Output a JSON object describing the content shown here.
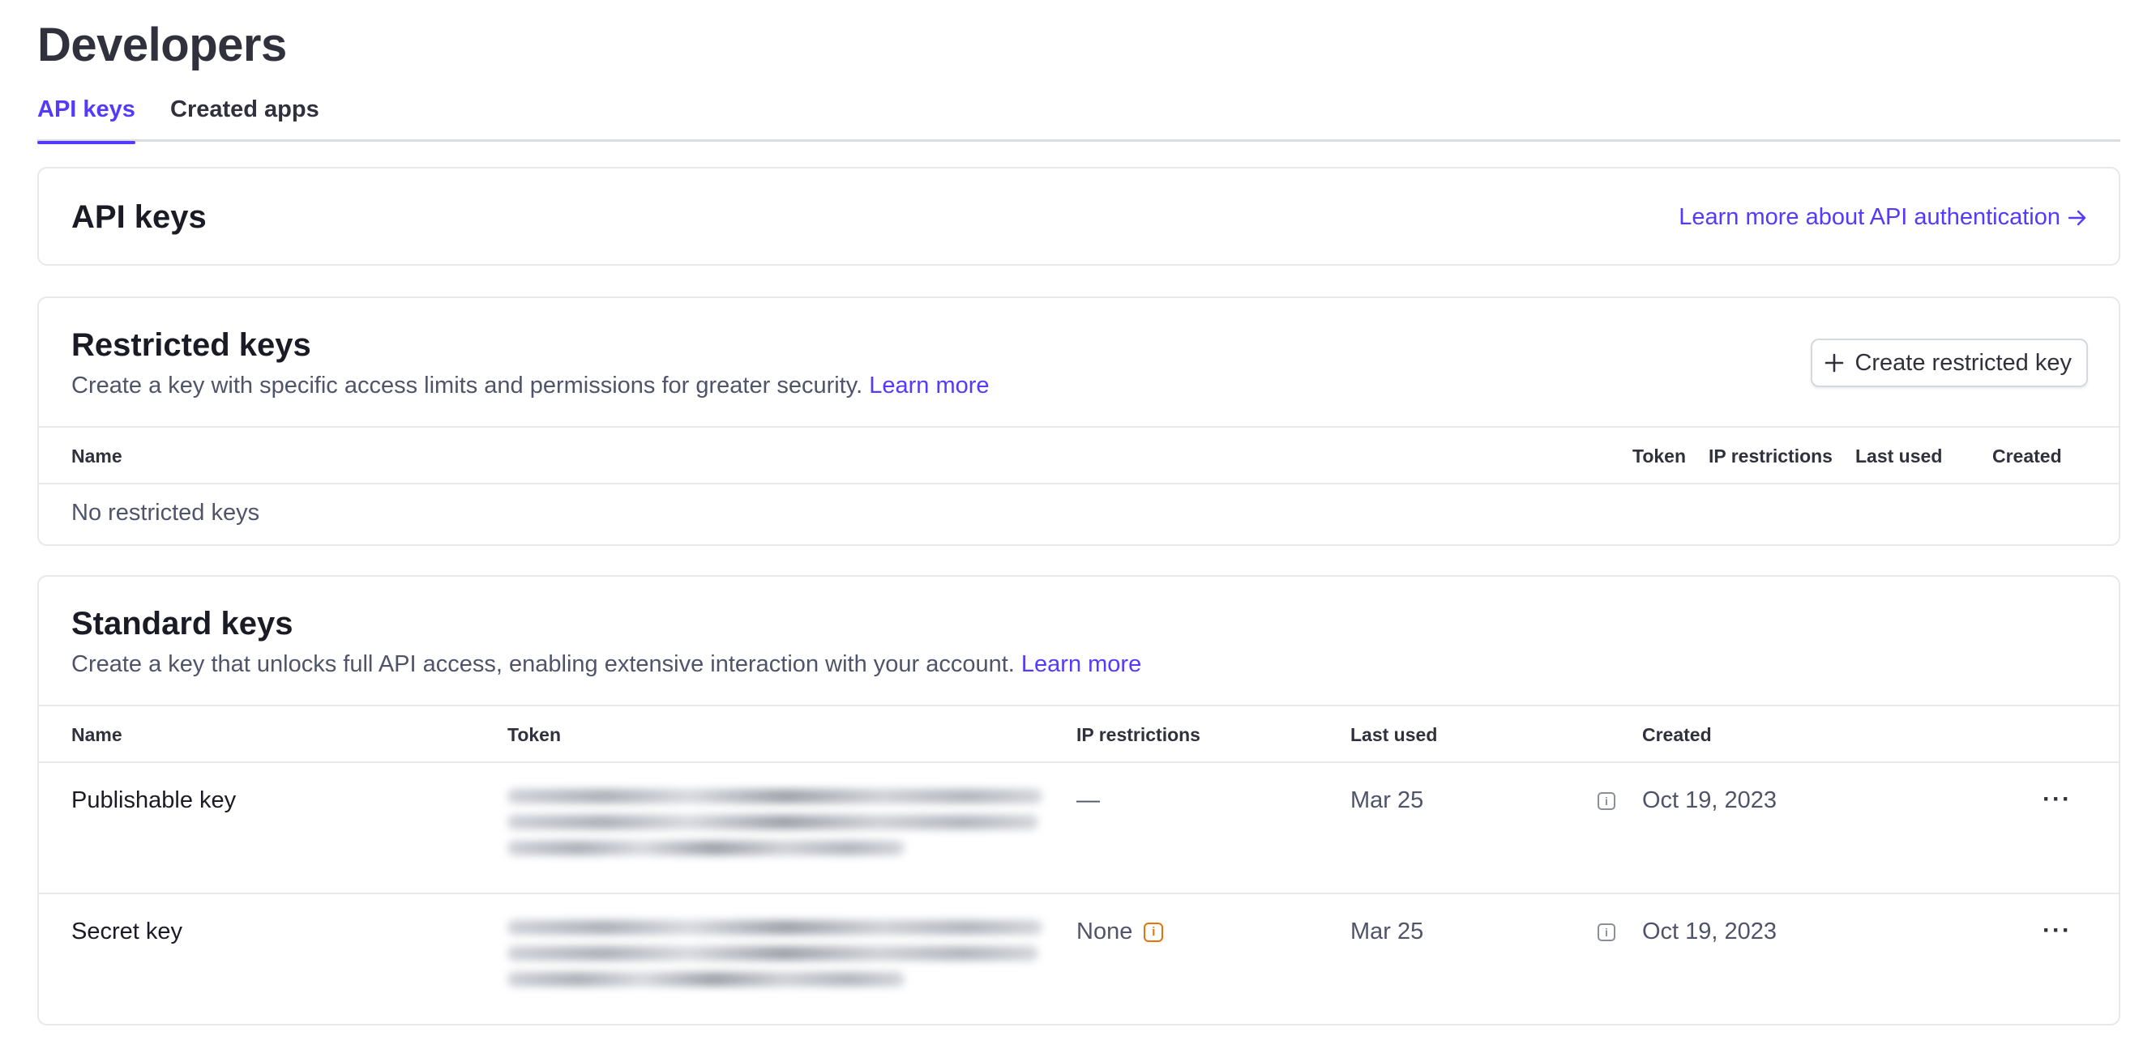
{
  "page": {
    "title": "Developers"
  },
  "tabs": [
    {
      "label": "API keys",
      "active": true
    },
    {
      "label": "Created apps",
      "active": false
    }
  ],
  "api_keys_card": {
    "title": "API keys",
    "auth_link": "Learn more about API authentication",
    "auth_link_icon": "arrow-right-icon"
  },
  "restricted": {
    "title": "Restricted keys",
    "desc": "Create a key with specific access limits and permissions for greater security.",
    "learn_more": "Learn more",
    "create_button": "Create restricted key",
    "columns": {
      "name": "Name",
      "token": "Token",
      "ip": "IP restrictions",
      "last_used": "Last used",
      "created": "Created"
    },
    "empty": "No restricted keys"
  },
  "standard": {
    "title": "Standard keys",
    "desc": "Create a key that unlocks full API access, enabling extensive interaction with your account.",
    "learn_more": "Learn more",
    "columns": {
      "name": "Name",
      "token": "Token",
      "ip": "IP restrictions",
      "last_used": "Last used",
      "created": "Created"
    },
    "rows": [
      {
        "name": "Publishable key",
        "ip": "—",
        "last_used": "Mar 25",
        "created": "Oct 19, 2023",
        "token_redacted": true
      },
      {
        "name": "Secret key",
        "ip": "None",
        "last_used": "Mar 25",
        "created": "Oct 19, 2023",
        "token_redacted": true,
        "ip_warning": true
      }
    ]
  },
  "colors": {
    "accent": "#533afd",
    "warning": "#e8710a",
    "border": "#e6e8ec"
  }
}
